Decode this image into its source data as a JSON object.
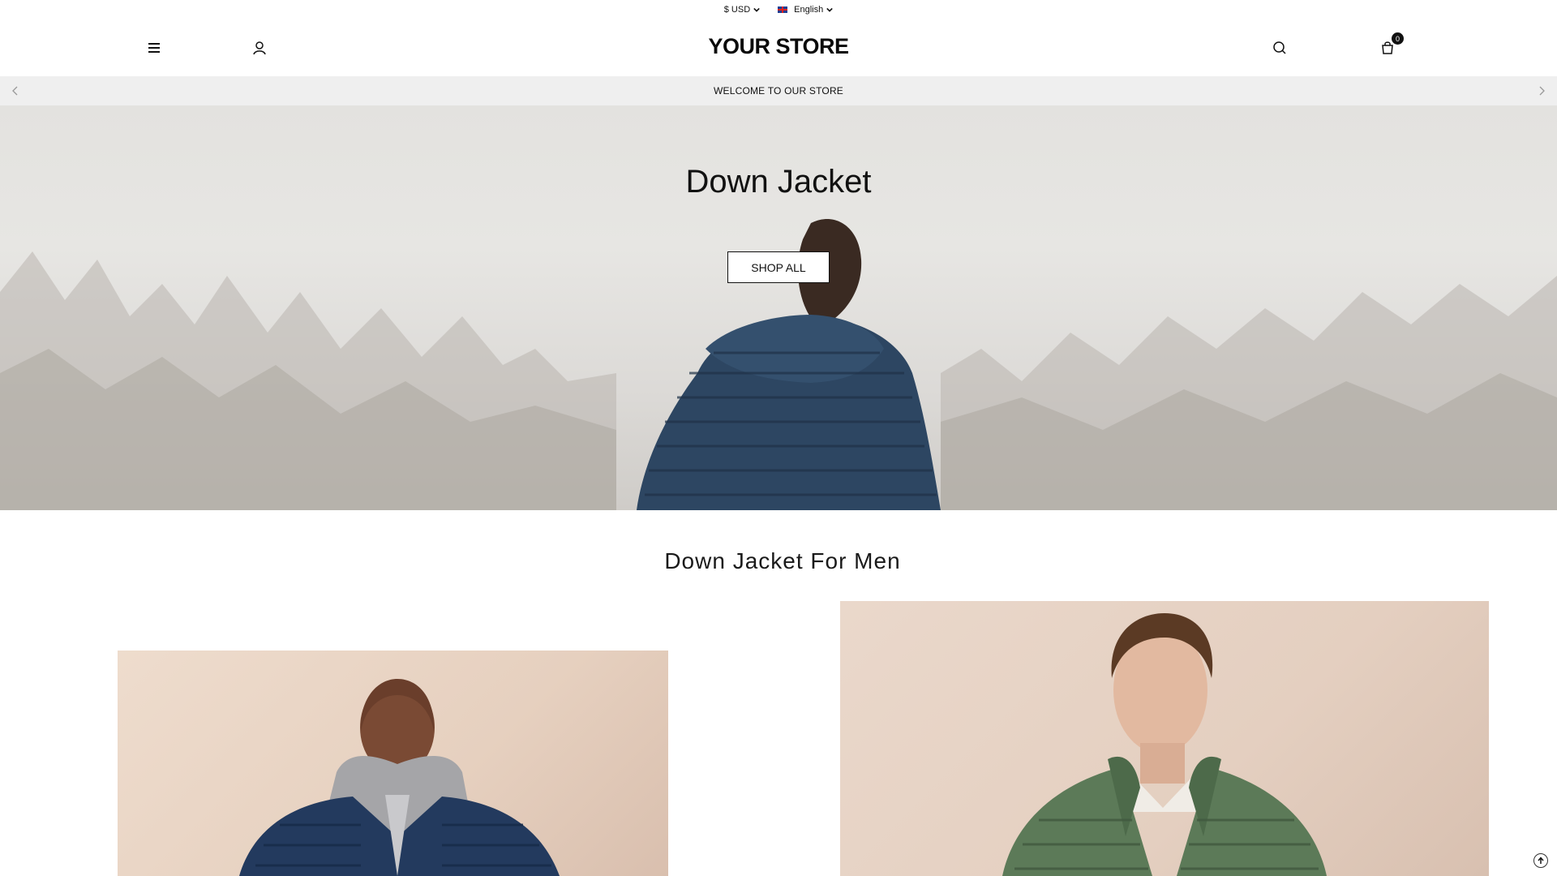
{
  "topbar": {
    "currency": "$ USD",
    "language": "English"
  },
  "header": {
    "logo": "YOUR STORE",
    "cart_count": "0",
    "icons": [
      "menu-icon",
      "account-icon",
      "search-icon",
      "cart-icon"
    ]
  },
  "announcement": {
    "text": "WELCOME TO OUR STORE"
  },
  "hero": {
    "title": "Down Jacket",
    "button_label": "SHOP ALL"
  },
  "collection": {
    "title": "Down Jacket For Men"
  },
  "colors": {
    "announce_bg": "#efefef",
    "jacket_navy": "#2c4460",
    "jacket_green": "#5c7a58"
  }
}
